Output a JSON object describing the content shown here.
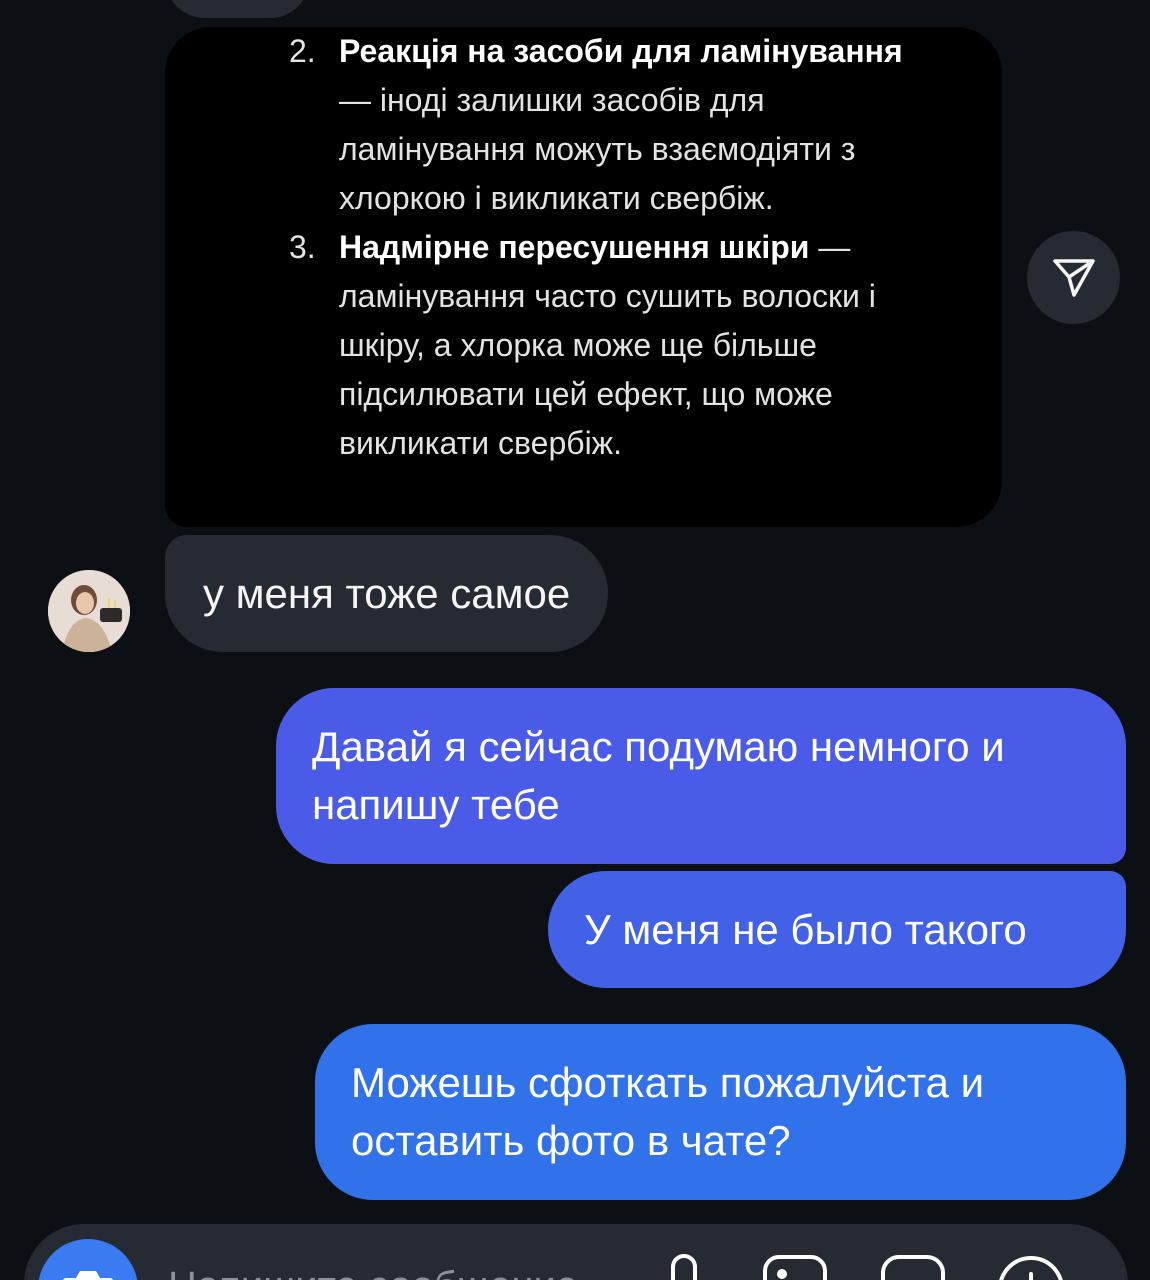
{
  "screenshot": {
    "items": [
      {
        "num": "2.",
        "bold": "Реакція на засоби для ламінування",
        "text": " — іноді залишки засобів для ламінування можуть взаємодіяти з хлоркою і викликати свербіж."
      },
      {
        "num": "3.",
        "bold": "Надмірне пересушення шкіри",
        "text": " — ламінування часто сушить волоски і шкіру, а хлорка може ще більше підсилювати цей ефект, що може викликати свербіж."
      }
    ]
  },
  "messages": {
    "incoming_1": "у меня тоже самое",
    "outgoing_1": "Давай я сейчас подумаю немного и напишу тебе",
    "outgoing_2": "У меня не было такого",
    "outgoing_3": "Можешь сфоткать пожалуйста и оставить фото в чате?"
  },
  "composer": {
    "placeholder": "Напишите сообщение…"
  },
  "icons": {
    "share": "paper-plane-icon",
    "camera": "camera-icon",
    "mic": "microphone-icon",
    "gallery": "gallery-icon",
    "sticker": "sticker-icon",
    "add": "plus-icon"
  },
  "colors": {
    "background": "#0c1014",
    "incoming_bubble": "#262a33",
    "outgoing_top": "#4a5be8",
    "outgoing_bottom": "#3172eb"
  }
}
